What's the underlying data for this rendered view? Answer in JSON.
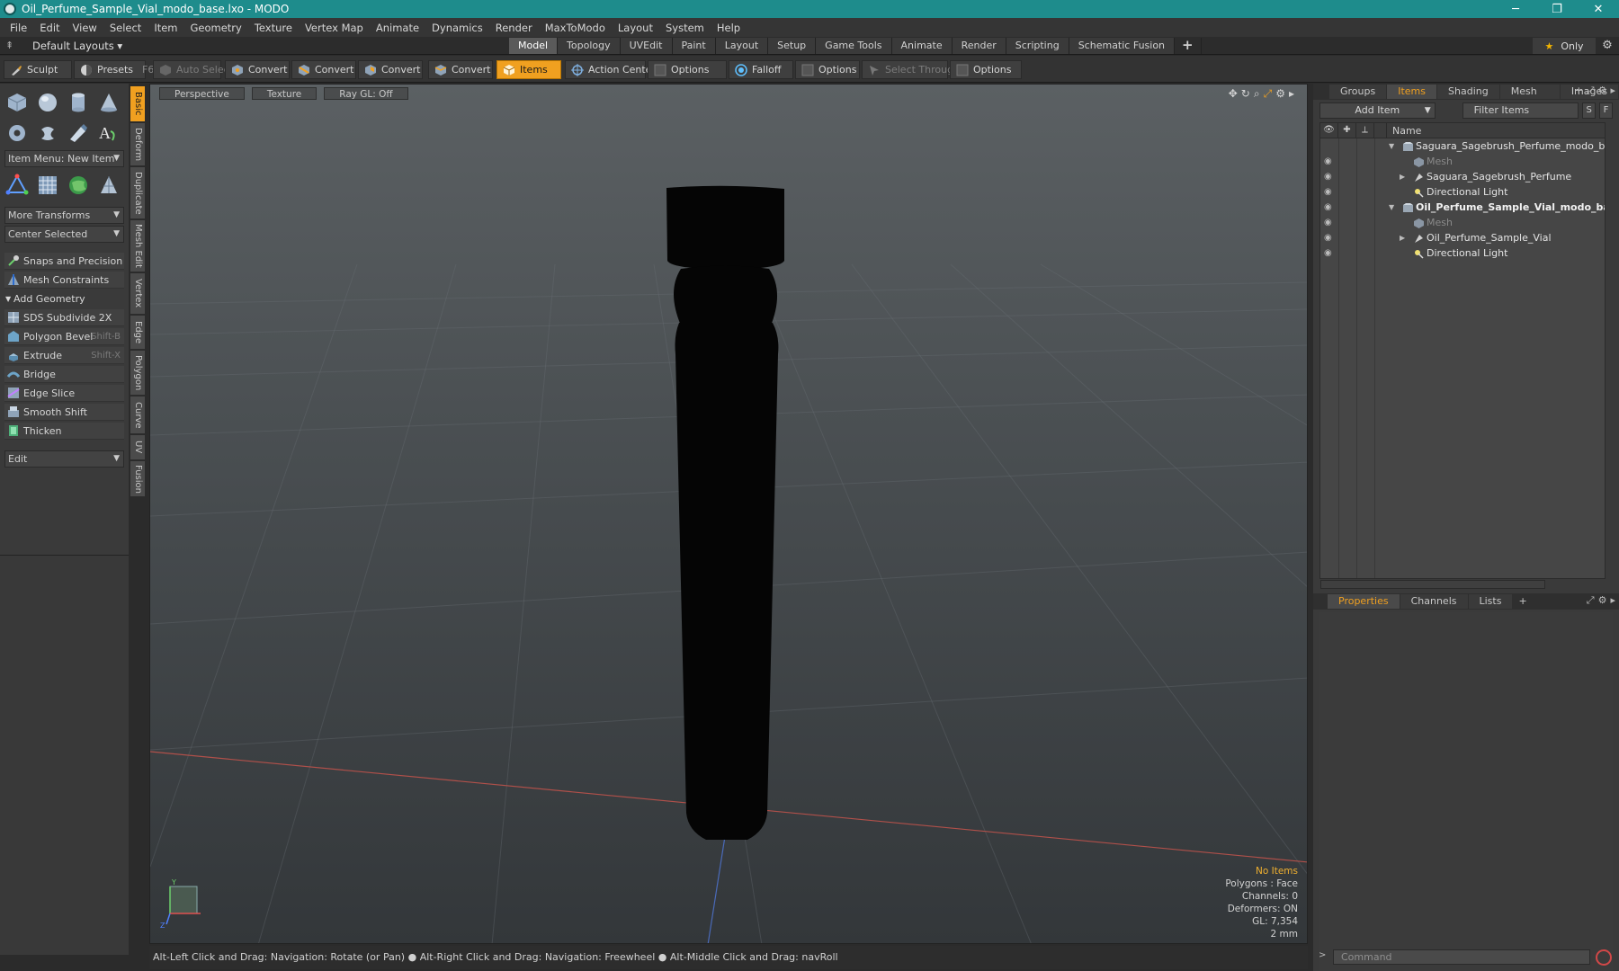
{
  "window": {
    "title": "Oil_Perfume_Sample_Vial_modo_base.lxo - MODO",
    "minimize": "─",
    "restore": "❐",
    "close": "✕"
  },
  "menu": [
    "File",
    "Edit",
    "View",
    "Select",
    "Item",
    "Geometry",
    "Texture",
    "Vertex Map",
    "Animate",
    "Dynamics",
    "Render",
    "MaxToModo",
    "Layout",
    "System",
    "Help"
  ],
  "layoutbar": {
    "default_layouts": "Default Layouts ▾",
    "tabs": [
      "Model",
      "Topology",
      "UVEdit",
      "Paint",
      "Layout",
      "Setup",
      "Game Tools",
      "Animate",
      "Render",
      "Scripting",
      "Schematic Fusion"
    ],
    "active_tab": "Model",
    "plus": "+",
    "only": "Only"
  },
  "toolbar": {
    "sculpt": "Sculpt",
    "presets": "Presets",
    "presets_shortcut": "F6",
    "auto_select": "Auto Select",
    "convert1": "Convert",
    "convert2": "Convert",
    "convert3": "Convert",
    "convert4": "Convert",
    "items": "Items",
    "action_center": "Action Center",
    "options1": "Options",
    "falloff": "Falloff",
    "options2": "Options",
    "select_through": "Select Through",
    "options3": "Options"
  },
  "leftpanel": {
    "item_menu": "Item Menu: New Item",
    "more_transforms": "More Transforms",
    "center_selected": "Center Selected",
    "snaps": "Snaps and Precision",
    "mesh_constraints": "Mesh Constraints",
    "add_geometry": "Add Geometry",
    "tools": [
      {
        "label": "SDS Subdivide 2X",
        "shortcut": ""
      },
      {
        "label": "Polygon Bevel",
        "shortcut": "Shift-B"
      },
      {
        "label": "Extrude",
        "shortcut": "Shift-X"
      },
      {
        "label": "Bridge",
        "shortcut": ""
      },
      {
        "label": "Edge Slice",
        "shortcut": ""
      },
      {
        "label": "Smooth Shift",
        "shortcut": ""
      },
      {
        "label": "Thicken",
        "shortcut": ""
      }
    ],
    "edit": "Edit"
  },
  "vtabs": [
    "Basic",
    "Deform",
    "Duplicate",
    "Mesh Edit",
    "Vertex",
    "Edge",
    "Polygon",
    "Curve",
    "UV",
    "Fusion"
  ],
  "viewport": {
    "perspective": "Perspective",
    "texture": "Texture",
    "raygl": "Ray GL: Off",
    "hud": {
      "no_items": "No Items",
      "polygons": "Polygons : Face",
      "channels": "Channels: 0",
      "deformers": "Deformers: ON",
      "gl": "GL: 7,354",
      "scale": "2 mm"
    }
  },
  "statusbar": "Alt-Left Click and Drag: Navigation: Rotate (or Pan) ● Alt-Right Click and Drag: Navigation: Freewheel ● Alt-Middle Click and Drag: navRoll",
  "rightpanel": {
    "tabs": [
      "Groups",
      "Items",
      "Shading",
      "Mesh ...",
      "Images"
    ],
    "active_tab": "Items",
    "add_item": "Add Item",
    "filter_items": "Filter Items",
    "s_btn": "S",
    "f_btn": "F",
    "name_header": "Name",
    "items": [
      {
        "label": "Saguara_Sagebrush_Perfume_modo_base ...",
        "type": "scene",
        "level": 0,
        "expanded": true,
        "style": ""
      },
      {
        "label": "Mesh",
        "type": "mesh",
        "level": 1,
        "style": "dim"
      },
      {
        "label": "Saguara_Sagebrush_Perfume",
        "type": "group",
        "level": 1,
        "collapsed": true,
        "style": ""
      },
      {
        "label": "Directional Light",
        "type": "light",
        "level": 1,
        "style": ""
      },
      {
        "label": "Oil_Perfume_Sample_Vial_modo_ba...",
        "type": "scene",
        "level": 0,
        "expanded": true,
        "style": "bold"
      },
      {
        "label": "Mesh",
        "type": "mesh",
        "level": 1,
        "style": "dim"
      },
      {
        "label": "Oil_Perfume_Sample_Vial",
        "type": "group",
        "level": 1,
        "collapsed": true,
        "style": ""
      },
      {
        "label": "Directional Light",
        "type": "light",
        "level": 1,
        "style": ""
      }
    ],
    "props_tabs": [
      "Properties",
      "Channels",
      "Lists"
    ],
    "props_active": "Properties",
    "command_placeholder": "Command"
  },
  "colors": {
    "accent": "#f0a020",
    "titlebar": "#1e8c8c"
  }
}
